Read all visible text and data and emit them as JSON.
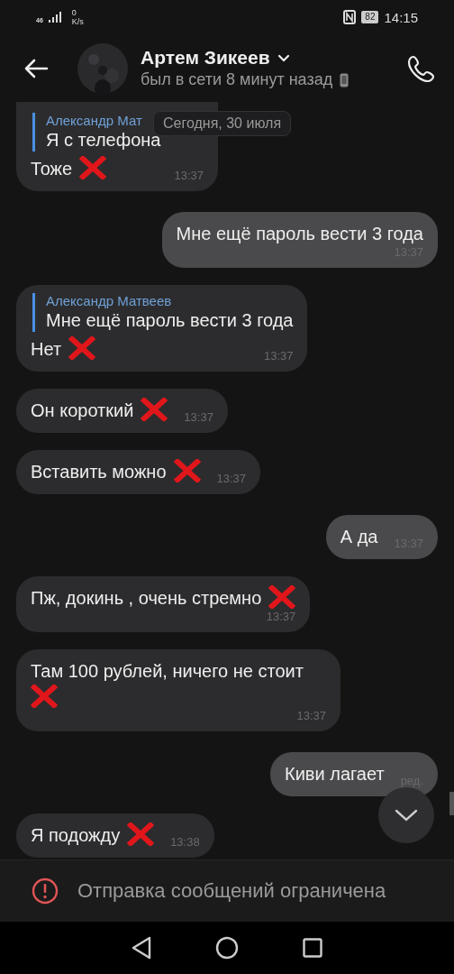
{
  "status_bar": {
    "network": "46",
    "speed_value": "0",
    "speed_unit": "K/s",
    "battery": "82",
    "time": "14:15"
  },
  "header": {
    "name": "Артем Зикеев",
    "status": "был в сети 8 минут назад"
  },
  "date_pill": "Сегодня, 30 июля",
  "messages": [
    {
      "kind": "incoming",
      "quote_author": "Александр Мат",
      "quote_text": "Я с телефона",
      "text": "Тоже",
      "crossed": true,
      "time": "13:37",
      "time_below": false
    },
    {
      "kind": "outgoing",
      "text": "Мне ещё пароль вести 3 года",
      "crossed": false,
      "time": "13:37",
      "time_below": true
    },
    {
      "kind": "incoming",
      "quote_author": "Александр Матвеев",
      "quote_text": "Мне ещё пароль вести 3 года",
      "text": "Нет",
      "crossed": true,
      "time": "13:37",
      "time_below": false
    },
    {
      "kind": "incoming",
      "text": "Он короткий",
      "crossed": true,
      "time": "13:37",
      "time_below": false
    },
    {
      "kind": "incoming",
      "text": "Вставить можно",
      "crossed": true,
      "time": "13:37",
      "time_below": false
    },
    {
      "kind": "outgoing",
      "text": "А да",
      "crossed": false,
      "time": "13:37",
      "time_below": false
    },
    {
      "kind": "incoming",
      "text": "Пж, докинь , очень стремно",
      "crossed": true,
      "time": "13:37",
      "time_below": true
    },
    {
      "kind": "incoming",
      "text": "Там 100 рублей, ничего не стоит",
      "crossed": true,
      "time": "13:37",
      "time_below": true
    },
    {
      "kind": "outgoing",
      "text": "Киви лагает",
      "crossed": false,
      "edited": "ред.",
      "time_below": false
    },
    {
      "kind": "incoming",
      "text": "Я подожду",
      "crossed": true,
      "time": "13:38",
      "time_below": false
    }
  ],
  "notice": "Отправка сообщений ограничена"
}
